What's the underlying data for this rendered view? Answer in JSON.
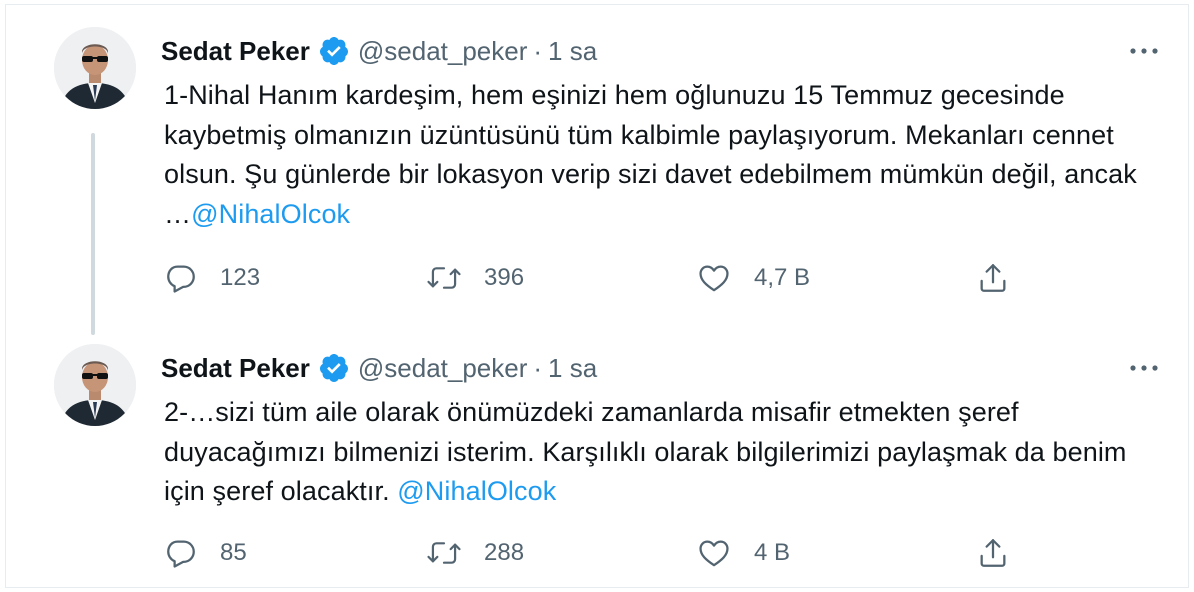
{
  "colors": {
    "text": "#0f1419",
    "secondary": "#536471",
    "link": "#1d9bf0",
    "verified": "#1d9bf0",
    "thread_line": "#cfd9de",
    "border": "#e6ecf0"
  },
  "tweets": [
    {
      "author": {
        "name": "Sedat Peker",
        "handle": "@sedat_peker",
        "verified": true
      },
      "separator": "·",
      "time": "1 sa",
      "text": "1-Nihal Hanım kardeşim, hem eşinizi hem oğlunuzu 15 Temmuz gecesinde kaybetmiş olmanızın üzüntüsünü tüm kalbimle paylaşıyorum. Mekanları cennet olsun. Şu günlerde bir lokasyon verip sizi davet edebilmem mümkün değil, ancak …",
      "mention": "@NihalOlcok",
      "stats": {
        "replies": "123",
        "retweets": "396",
        "likes": "4,7 B"
      }
    },
    {
      "author": {
        "name": "Sedat Peker",
        "handle": "@sedat_peker",
        "verified": true
      },
      "separator": "·",
      "time": "1 sa",
      "text": "2-…sizi tüm aile olarak önümüzdeki zamanlarda misafir etmekten şeref duyacağımızı bilmenizi isterim. Karşılıklı olarak bilgilerimizi paylaşmak da benim için şeref olacaktır. ",
      "mention": "@NihalOlcok",
      "stats": {
        "replies": "85",
        "retweets": "288",
        "likes": "4 B"
      }
    }
  ],
  "icons": {
    "verified": "verified-badge-icon",
    "more": "more-dots-icon",
    "reply": "reply-bubble-icon",
    "retweet": "retweet-icon",
    "like": "heart-icon",
    "share": "share-upload-icon"
  }
}
